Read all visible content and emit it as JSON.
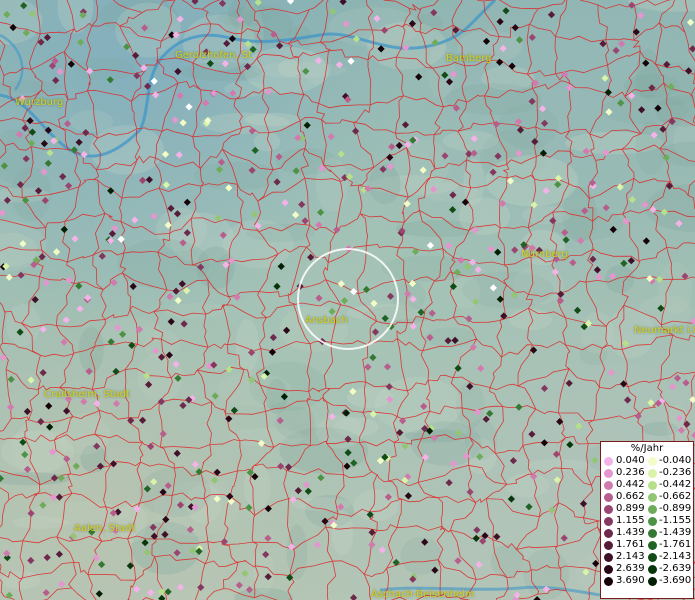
{
  "map": {
    "cities": [
      {
        "id": "gerolzhofen",
        "label": "Gerolzhofen, St"
      },
      {
        "id": "bamberg",
        "label": "Bamberg"
      },
      {
        "id": "wuerzburg",
        "label": "Würzburg"
      },
      {
        "id": "nuernberg",
        "label": "Nürnberg"
      },
      {
        "id": "ansbach",
        "label": "Ansbach"
      },
      {
        "id": "neumarkt",
        "label": "Neumarkt i.O"
      },
      {
        "id": "crailsheim",
        "label": "Crailsheim, Stadt"
      },
      {
        "id": "aalen",
        "label": "Aalen, Stadt"
      },
      {
        "id": "aschach",
        "label": "Aschach-Beisenheim"
      }
    ],
    "colors": {
      "border": "#e02020",
      "river": "#3f96c8",
      "circle": "#ffffff",
      "city_label": "#d6d018"
    }
  },
  "legend": {
    "unit": "%/Jahr",
    "positive": [
      {
        "value": "0.040",
        "color": "#f4b3e8"
      },
      {
        "value": "0.236",
        "color": "#e496cf"
      },
      {
        "value": "0.442",
        "color": "#d27aae"
      },
      {
        "value": "0.662",
        "color": "#b75e8c"
      },
      {
        "value": "0.899",
        "color": "#9b4670"
      },
      {
        "value": "1.155",
        "color": "#843860"
      },
      {
        "value": "1.439",
        "color": "#6d2a4c"
      },
      {
        "value": "1.761",
        "color": "#561c38"
      },
      {
        "value": "2.143",
        "color": "#3f1027"
      },
      {
        "value": "2.639",
        "color": "#2a0717"
      },
      {
        "value": "3.690",
        "color": "#150208"
      }
    ],
    "negative": [
      {
        "value": "-0.040",
        "color": "#f2fcc6"
      },
      {
        "value": "-0.236",
        "color": "#d9f4a8"
      },
      {
        "value": "-0.442",
        "color": "#b6e08a"
      },
      {
        "value": "-0.662",
        "color": "#92c672"
      },
      {
        "value": "-0.899",
        "color": "#6fac5a"
      },
      {
        "value": "-1.155",
        "color": "#4d9245"
      },
      {
        "value": "-1.439",
        "color": "#357a34"
      },
      {
        "value": "-1.761",
        "color": "#216324"
      },
      {
        "value": "-2.143",
        "color": "#114c16"
      },
      {
        "value": "-2.639",
        "color": "#07360b"
      },
      {
        "value": "-3.690",
        "color": "#021f04"
      }
    ]
  }
}
